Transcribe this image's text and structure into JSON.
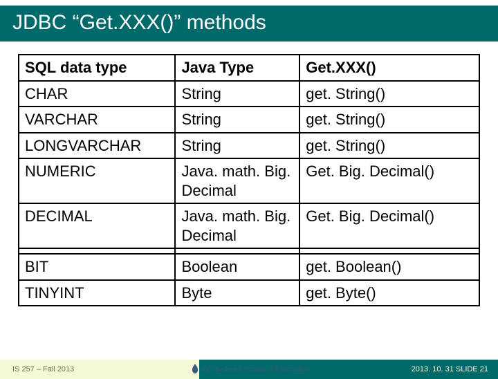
{
  "title": "JDBC “Get.XXX()” methods",
  "table": {
    "headers": {
      "c1": "SQL data type",
      "c2": "Java Type",
      "c3": "Get.XXX()"
    },
    "rows": [
      {
        "c1": "CHAR",
        "c2": "String",
        "c3": "get. String()"
      },
      {
        "c1": "VARCHAR",
        "c2": "String",
        "c3": "get. String()"
      },
      {
        "c1": "LONGVARCHAR",
        "c2": "String",
        "c3": "get. String()"
      },
      {
        "c1": "NUMERIC",
        "c2": "Java. math. Big. Decimal",
        "c3": "Get. Big. Decimal()"
      },
      {
        "c1": "DECIMAL",
        "c2": "Java. math. Big. Decimal",
        "c3": "Get. Big. Decimal()"
      },
      {
        "c1": "BIT",
        "c2": "Boolean",
        "c3": "get. Boolean()"
      },
      {
        "c1": "TINYINT",
        "c2": "Byte",
        "c3": "get. Byte()"
      }
    ]
  },
  "footer": {
    "left": "IS 257 – Fall 2013",
    "logo": "UC Berkeley School of Information",
    "right": "2013. 10. 31 SLIDE 21"
  }
}
